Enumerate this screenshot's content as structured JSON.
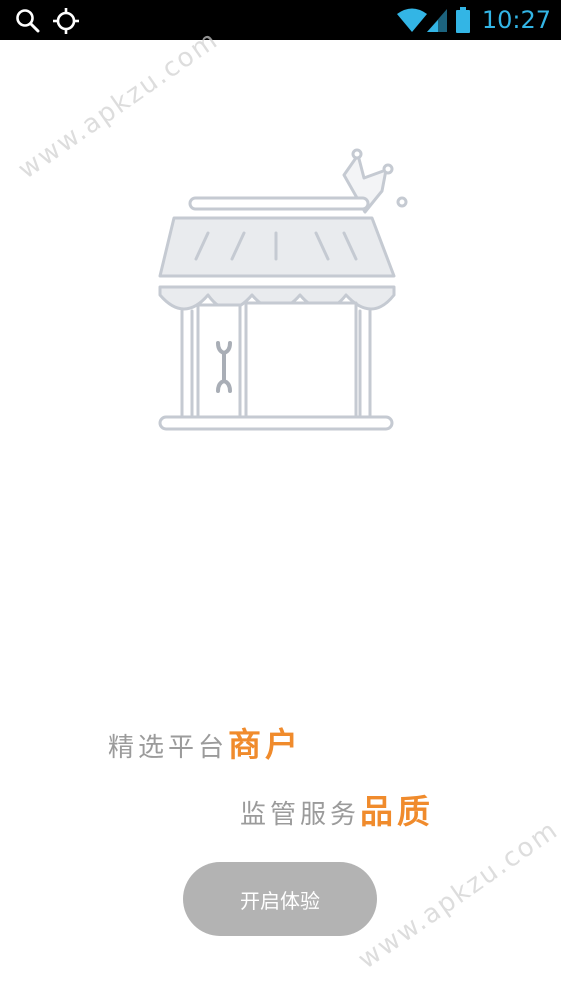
{
  "status_bar": {
    "time": "10:27",
    "left_icons": [
      "search-icon",
      "gps-icon"
    ],
    "right_icons": [
      "wifi-icon",
      "signal-icon",
      "battery-icon"
    ],
    "accent_color": "#33b5e5"
  },
  "illustration": {
    "icon": "storefront-with-crown-icon",
    "inner_icon": "wrench-icon"
  },
  "tagline": {
    "line1_plain": "精选平台",
    "line1_accent": "商户",
    "line2_plain": "监管服务",
    "line2_accent": "品质",
    "accent_color": "#f08b2c"
  },
  "start_button": {
    "label": "开启体验"
  },
  "watermark": {
    "text": "www.apkzu.com"
  }
}
